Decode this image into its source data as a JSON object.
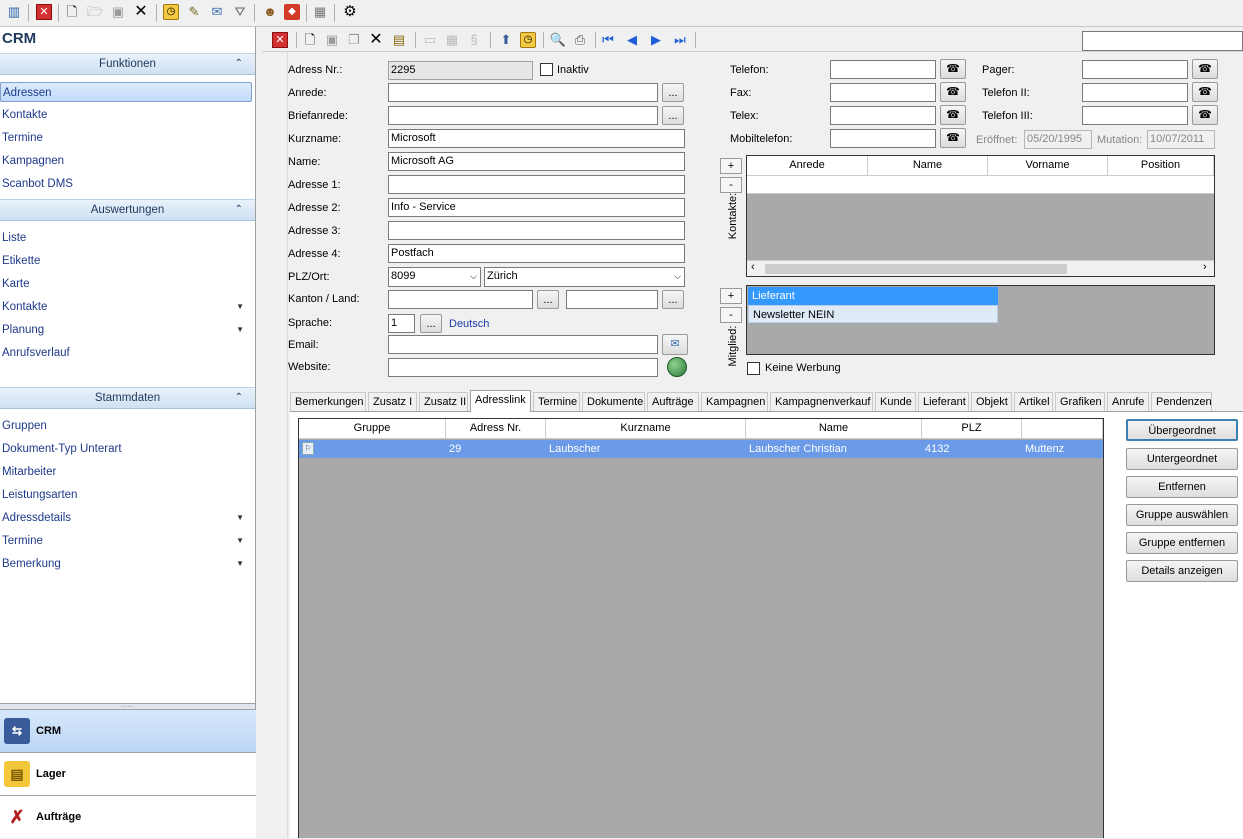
{
  "toolbar": {
    "icons": [
      "chart-icon",
      "close-red-icon",
      "new-doc-icon",
      "open-folder-icon",
      "save-icon",
      "delete-x-icon",
      "clock-icon",
      "lock-edit-icon",
      "mail-icon",
      "filter-icon",
      "user-icon",
      "print-red-icon",
      "grid-icon",
      "settings-icon"
    ]
  },
  "sidebar": {
    "title": "CRM",
    "funktionen": {
      "header": "Funktionen",
      "items": [
        "Adressen",
        "Kontakte",
        "Termine",
        "Kampagnen",
        "Scanbot DMS"
      ]
    },
    "auswertungen": {
      "header": "Auswertungen",
      "items": [
        "Liste",
        "Etikette",
        "Karte",
        "Kontakte",
        "Planung",
        "Anrufsverlauf"
      ]
    },
    "stammdaten": {
      "header": "Stammdaten",
      "items": [
        "Gruppen",
        "Dokument-Typ Unterart",
        "Mitarbeiter",
        "Leistungsarten",
        "Adressdetails",
        "Termine",
        "Bemerkung"
      ]
    },
    "bottom": [
      "CRM",
      "Lager",
      "Aufträge"
    ]
  },
  "form": {
    "adress_nr_label": "Adress Nr.:",
    "adress_nr": "2295",
    "inaktiv": "Inaktiv",
    "anrede_label": "Anrede:",
    "anrede": "",
    "briefanrede_label": "Briefanrede:",
    "briefanrede": "",
    "kurzname_label": "Kurzname:",
    "kurzname": "Microsoft",
    "name_label": "Name:",
    "name": "Microsoft AG",
    "adresse1_label": "Adresse 1:",
    "adresse1": "",
    "adresse2_label": "Adresse 2:",
    "adresse2": "Info - Service",
    "adresse3_label": "Adresse 3:",
    "adresse3": "",
    "adresse4_label": "Adresse 4:",
    "adresse4": "Postfach",
    "plz_label": "PLZ/Ort:",
    "plz": "8099",
    "ort": "Zürich",
    "kanton_label": "Kanton / Land:",
    "kanton": "",
    "land": "",
    "sprache_label": "Sprache:",
    "sprache": "1",
    "sprache_text": "Deutsch",
    "email_label": "Email:",
    "email": "",
    "website_label": "Website:",
    "website": "",
    "ellipsis": "...",
    "telefon_label": "Telefon:",
    "fax_label": "Fax:",
    "telex_label": "Telex:",
    "mobil_label": "Mobiltelefon:",
    "pager_label": "Pager:",
    "telefon2_label": "Telefon II:",
    "telefon3_label": "Telefon III:",
    "eroeffnet_label": "Eröffnet:",
    "eroeffnet": "05/20/1995",
    "mutation_label": "Mutation:",
    "mutation": "10/07/2011",
    "kontakte_label": "Kontakte:",
    "kontakte_cols": [
      "Anrede",
      "Name",
      "Vorname",
      "Position"
    ],
    "mitglied_label": "Mitglied:",
    "mitglied_items": [
      "Lieferant",
      "Newsletter NEIN"
    ],
    "keine_werbung": "Keine Werbung",
    "plus": "+",
    "minus": "-"
  },
  "tabs": [
    "Bemerkungen",
    "Zusatz I",
    "Zusatz II",
    "Adresslink",
    "Termine",
    "Dokumente",
    "Aufträge",
    "Kampagnen",
    "Kampagnenverkauf",
    "Kunde",
    "Lieferant",
    "Objekt",
    "Artikel",
    "Grafiken",
    "Anrufe",
    "Pendenzen"
  ],
  "link_grid": {
    "cols": [
      "Gruppe",
      "Adress Nr.",
      "Kurzname",
      "Name",
      "PLZ",
      ""
    ],
    "row": [
      "",
      "29",
      "Laubscher",
      "Laubscher Christian",
      "4132",
      "Muttenz"
    ]
  },
  "right_buttons": [
    "Übergeordnet",
    "Untergeordnet",
    "Entfernen",
    "Gruppe auswählen",
    "Gruppe entfernen",
    "Details anzeigen"
  ],
  "colors": {
    "accent": "#3399ff",
    "selection": "#6b9ae8",
    "header": "#1e395b"
  }
}
